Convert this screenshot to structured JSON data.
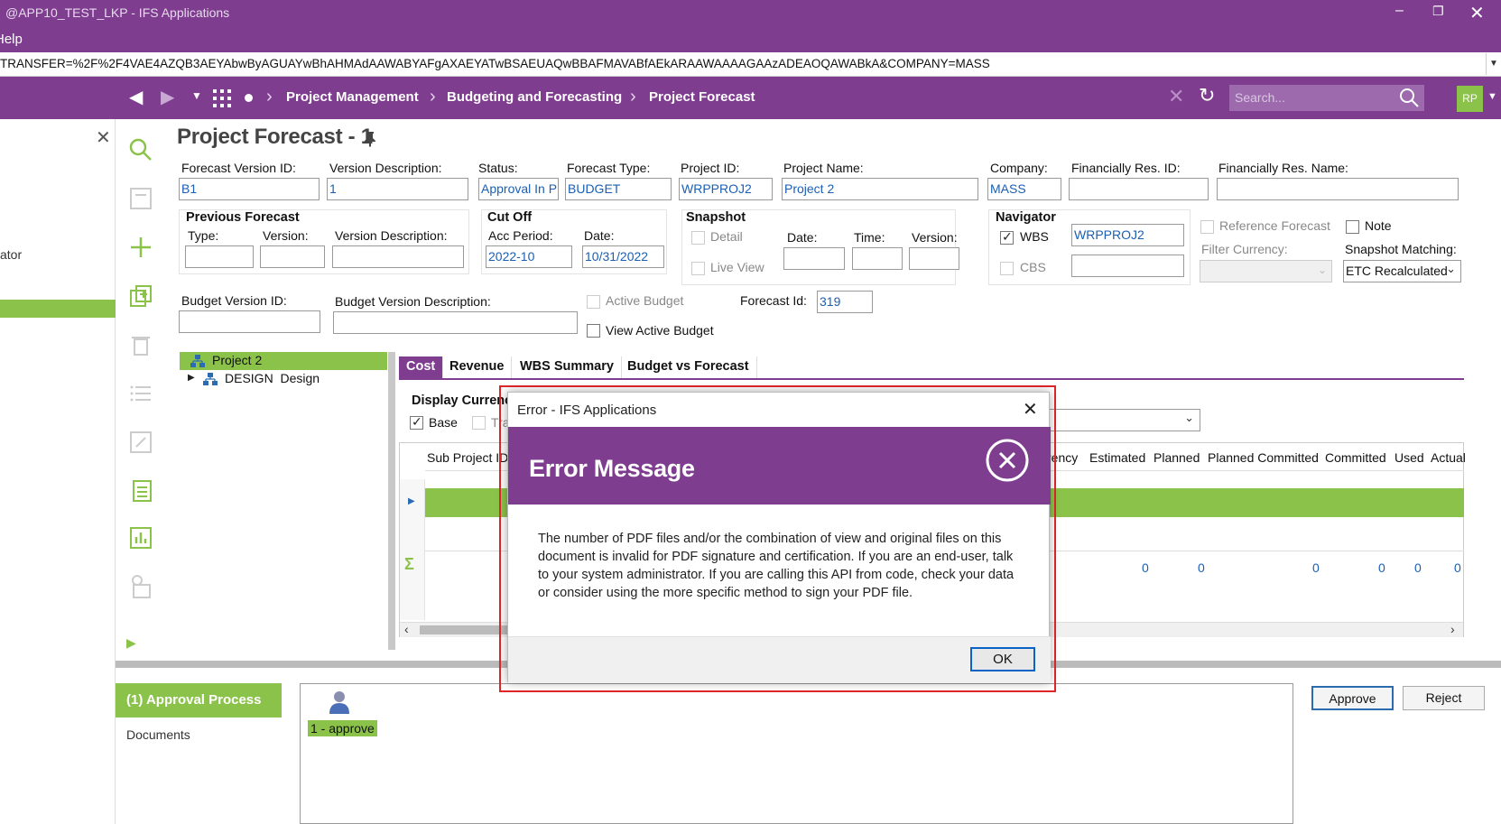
{
  "window": {
    "title": "@APP10_TEST_LKP - IFS Applications",
    "menu_help": "Help",
    "url": "TRANSFER=%2F%2F4VAE4AZQB3AEYAbwByAGUAYwBhAHMAdAAWABYAFgAXAEYATwBSAEUAQwBBAFMAVABfAEkARAAWAAAAGAAzADEAOQAWABkA&COMPANY=MASS"
  },
  "nav": {
    "breadcrumbs": [
      "Project Management",
      "Budgeting and Forecasting",
      "Project Forecast"
    ],
    "search_placeholder": "Search...",
    "user_initials": "RP"
  },
  "left_panel": {
    "label": "ator"
  },
  "form": {
    "page_title": "Project Forecast - 1",
    "forecast_version_id_label": "Forecast Version ID:",
    "forecast_version_id": "B1",
    "version_description_label": "Version Description:",
    "version_description": "1",
    "status_label": "Status:",
    "status": "Approval In P",
    "forecast_type_label": "Forecast Type:",
    "forecast_type": "BUDGET",
    "project_id_label": "Project ID:",
    "project_id": "WRPPROJ2",
    "project_name_label": "Project Name:",
    "project_name": "Project 2",
    "company_label": "Company:",
    "company": "MASS",
    "fin_res_id_label": "Financially Res. ID:",
    "fin_res_name_label": "Financially Res. Name:",
    "previous_forecast": {
      "heading": "Previous Forecast",
      "type_label": "Type:",
      "version_label": "Version:",
      "version_desc_label": "Version Description:"
    },
    "cut_off": {
      "heading": "Cut Off",
      "acc_period_label": "Acc Period:",
      "acc_period": "2022-10",
      "date_label": "Date:",
      "date": "10/31/2022"
    },
    "snapshot": {
      "heading": "Snapshot",
      "detail_label": "Detail",
      "live_view_label": "Live View",
      "date_label": "Date:",
      "time_label": "Time:",
      "version_label": "Version:"
    },
    "navigator": {
      "heading": "Navigator",
      "wbs_label": "WBS",
      "wbs_value": "WRPPROJ2",
      "cbs_label": "CBS"
    },
    "reference_forecast_label": "Reference Forecast",
    "note_label": "Note",
    "filter_currency_label": "Filter Currency:",
    "snapshot_matching_label": "Snapshot Matching:",
    "snapshot_matching": "ETC Recalculated",
    "budget_version_id_label": "Budget Version ID:",
    "budget_version_desc_label": "Budget Version Description:",
    "active_budget_label": "Active Budget",
    "view_active_budget_label": "View Active Budget",
    "forecast_id_label": "Forecast Id:",
    "forecast_id": "319"
  },
  "tree": {
    "root": "Project 2",
    "child": "DESIGN  Design"
  },
  "tabs": [
    "Cost",
    "Revenue",
    "WBS Summary",
    "Budget vs Forecast"
  ],
  "cost_tab": {
    "display_currency_label": "Display Currenc",
    "base_label": "Base",
    "trans_label": "Tra"
  },
  "grid": {
    "col_sub_project": "Sub Project ID",
    "col_currency": "rency",
    "col_estimated": "Estimated",
    "col_planned": "Planned",
    "col_planned_committed": "Planned Committed",
    "col_committed": "Committed",
    "col_used": "Used",
    "col_actual": "Actual",
    "totals": [
      "0",
      "0",
      "0",
      "0",
      "0",
      "0"
    ]
  },
  "bottom": {
    "approval_process": "(1) Approval Process",
    "documents": "Documents",
    "step_label": "1 - approve",
    "approve_button": "Approve",
    "reject_button": "Reject"
  },
  "dialog": {
    "window_title": "Error - IFS Applications",
    "heading": "Error Message",
    "message": "The number of PDF files and/or the combination of view and original files on this document is invalid for PDF signature and certification. If you are an end-user, talk to your system administrator. If you are calling this API from code, check your data or consider using the more specific method to sign your PDF file.",
    "ok_button": "OK"
  },
  "colors": {
    "brand_purple": "#7e3d8f",
    "accent_green": "#8bc34a",
    "highlight_red": "#e0262b",
    "link_blue": "#1a5fb4"
  }
}
